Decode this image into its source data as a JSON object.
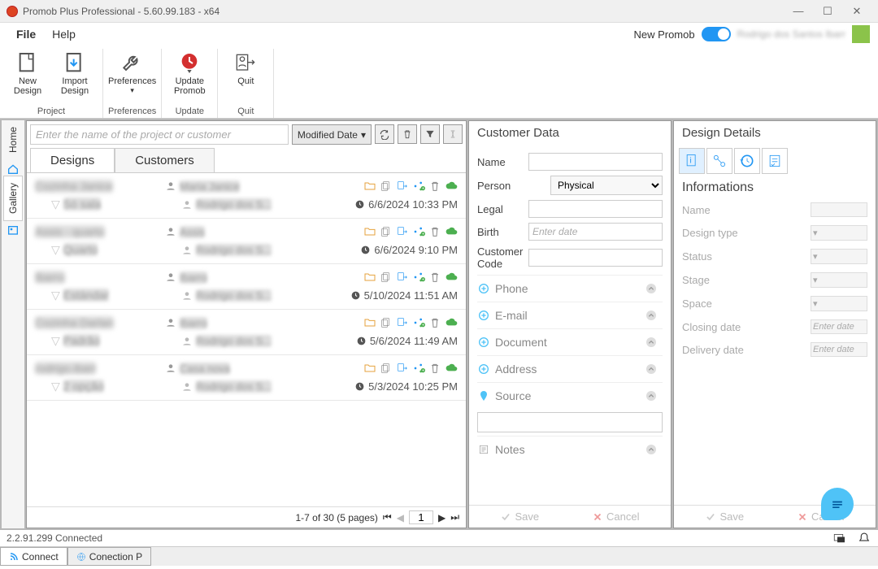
{
  "window": {
    "title": "Promob Plus Professional - 5.60.99.183 - x64"
  },
  "menubar": {
    "file": "File",
    "help": "Help",
    "new_promob": "New Promob",
    "user": "Rodrigo dos Santos Ibarr"
  },
  "ribbon": {
    "project": {
      "label": "Project",
      "new_design": "New Design",
      "import_design": "Import Design"
    },
    "preferences": {
      "label": "Preferences",
      "btn": "Preferences"
    },
    "update": {
      "label": "Update",
      "btn": "Update Promob"
    },
    "quit": {
      "label": "Quit",
      "btn": "Quit"
    }
  },
  "side": {
    "home": "Home",
    "gallery": "Gallery"
  },
  "search": {
    "placeholder": "Enter the name of the project or customer",
    "sort": "Modified Date"
  },
  "tabs": {
    "designs": "Designs",
    "customers": "Customers"
  },
  "designs": [
    {
      "name": "Cozinha Janice",
      "cust": "Maria Janice",
      "sub": "Só sala",
      "auth": "Rodrigo dos S...",
      "date": "6/6/2024 10:33 PM"
    },
    {
      "name": "Assis - quarto",
      "cust": "Assis",
      "sub": "Quarto",
      "auth": "Rodrigo dos S...",
      "date": "6/6/2024 9:10 PM"
    },
    {
      "name": "Ibarro",
      "cust": "Ibarro",
      "sub": "Estándar",
      "auth": "Rodrigo dos S...",
      "date": "5/10/2024 11:51 AM"
    },
    {
      "name": "Cozinha Darlan",
      "cust": "Ibarro",
      "sub": "Padrão",
      "auth": "Rodrigo dos S...",
      "date": "5/6/2024 11:49 AM"
    },
    {
      "name": "rodrigo.ibarr",
      "cust": "Casa nova",
      "sub": "2 opção",
      "auth": "Rodrigo dos S...",
      "date": "5/3/2024 10:25 PM"
    }
  ],
  "pagination": {
    "text": "1-7 of 30 (5 pages)",
    "page": "1"
  },
  "customer_panel": {
    "title": "Customer Data",
    "name": "Name",
    "person": "Person",
    "person_value": "Physical",
    "legal": "Legal",
    "birth": "Birth",
    "birth_ph": "Enter date",
    "code": "Customer Code",
    "phone": "Phone",
    "email": "E-mail",
    "document": "Document",
    "address": "Address",
    "source": "Source",
    "notes": "Notes",
    "save": "Save",
    "cancel": "Cancel"
  },
  "details_panel": {
    "title": "Design Details",
    "info_title": "Informations",
    "name": "Name",
    "design_type": "Design type",
    "status": "Status",
    "stage": "Stage",
    "space": "Space",
    "closing": "Closing date",
    "delivery": "Delivery date",
    "date_ph": "Enter date",
    "save": "Save",
    "cancel": "Cancel"
  },
  "status": {
    "text": "2.2.91.299  Connected"
  },
  "bottom_tabs": {
    "connect": "Connect",
    "conn_p": "Conection P"
  }
}
